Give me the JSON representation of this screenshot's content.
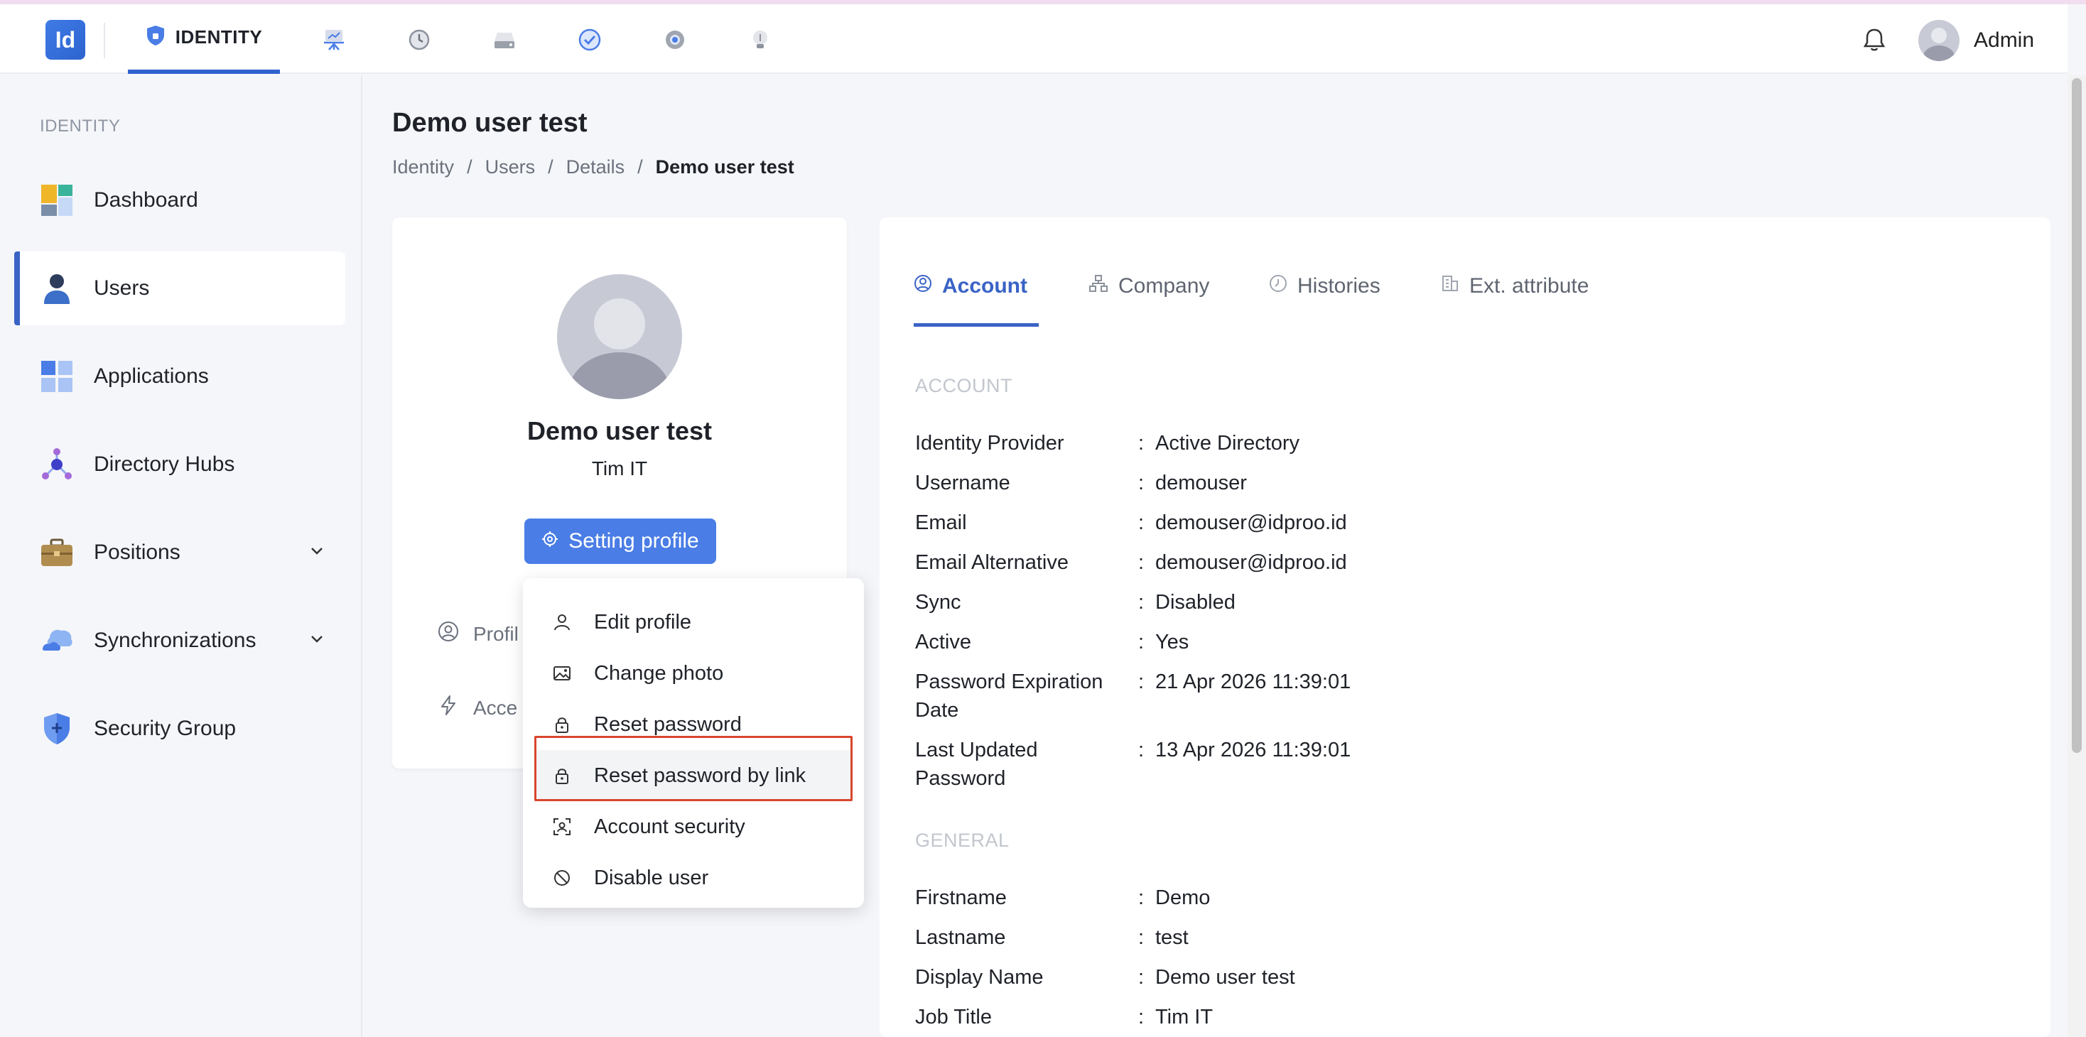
{
  "app": {
    "logo_text": "Id",
    "module_label": "IDENTITY",
    "user_name": "Admin"
  },
  "sidebar": {
    "section_label": "IDENTITY",
    "items": [
      {
        "label": "Dashboard"
      },
      {
        "label": "Users"
      },
      {
        "label": "Applications"
      },
      {
        "label": "Directory Hubs"
      },
      {
        "label": "Positions"
      },
      {
        "label": "Synchronizations"
      },
      {
        "label": "Security Group"
      }
    ]
  },
  "page": {
    "title": "Demo user test",
    "breadcrumb": [
      "Identity",
      "Users",
      "Details",
      "Demo user test"
    ],
    "breadcrumb_sep": "/"
  },
  "profile": {
    "name": "Demo user test",
    "department": "Tim IT",
    "setting_button": "Setting profile",
    "links": [
      "Profil",
      "Acce"
    ]
  },
  "dropdown": {
    "items": [
      "Edit profile",
      "Change photo",
      "Reset password",
      "Reset password by link",
      "Account security",
      "Disable user"
    ]
  },
  "tabs": [
    "Account",
    "Company",
    "Histories",
    "Ext. attribute"
  ],
  "details": {
    "separator": ":",
    "account_section": "ACCOUNT",
    "account": [
      {
        "k": "Identity Provider",
        "v": "Active Directory"
      },
      {
        "k": "Username",
        "v": "demouser"
      },
      {
        "k": "Email",
        "v": "demouser@idproo.id"
      },
      {
        "k": "Email Alternative",
        "v": "demouser@idproo.id"
      },
      {
        "k": "Sync",
        "v": "Disabled"
      },
      {
        "k": "Active",
        "v": "Yes"
      },
      {
        "k1": "Password Expiration",
        "k2": "Date",
        "v": "21 Apr 2026 11:39:01"
      },
      {
        "k1": "Last Updated",
        "k2": "Password",
        "v": "13 Apr 2026 11:39:01"
      }
    ],
    "general_section": "GENERAL",
    "general": [
      {
        "k": "Firstname",
        "v": "Demo"
      },
      {
        "k": "Lastname",
        "v": "test"
      },
      {
        "k": "Display Name",
        "v": "Demo user test"
      },
      {
        "k": "Job Title",
        "v": "Tim IT"
      }
    ]
  },
  "colors": {
    "accent": "#3a63c6",
    "button": "#4a7de6",
    "highlight_border": "#d8462e"
  }
}
